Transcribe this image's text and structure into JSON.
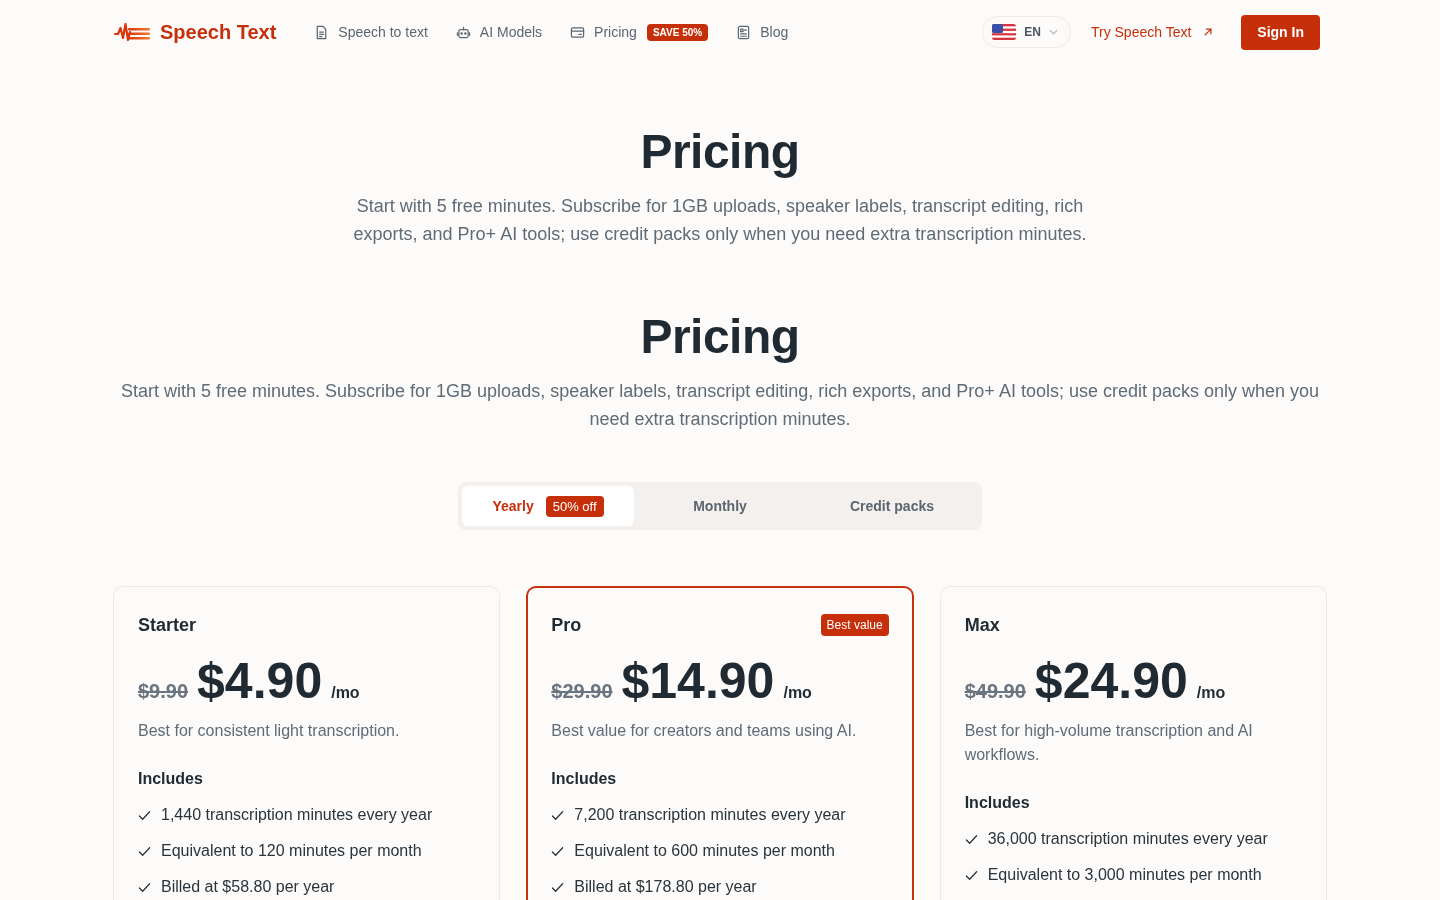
{
  "nav": {
    "brand": "Speech Text",
    "links": [
      {
        "label": "Speech to text"
      },
      {
        "label": "AI Models"
      },
      {
        "label": "Pricing",
        "badge": "SAVE 50%"
      },
      {
        "label": "Blog"
      }
    ],
    "language": "EN",
    "try_link": "Try Speech Text",
    "sign_in": "Sign In"
  },
  "page_header": {
    "title": "Pricing",
    "subtitle": "Start with 5 free minutes. Subscribe for 1GB uploads, speaker labels, transcript editing, rich exports, and Pro+ AI tools; use credit packs only when you need extra transcription minutes."
  },
  "pricing_section": {
    "title": "Pricing",
    "subtitle": "Start with 5 free minutes. Subscribe for 1GB uploads, speaker labels, transcript editing, rich exports, and Pro+ AI tools; use credit packs only when you need extra transcription minutes.",
    "billing_tabs": [
      {
        "label": "Yearly",
        "badge": "50% off",
        "selected": true
      },
      {
        "label": "Monthly",
        "selected": false
      },
      {
        "label": "Credit packs",
        "selected": false
      }
    ],
    "plans": [
      {
        "name": "Starter",
        "highlighted": false,
        "old_price": "$9.90",
        "price": "$4.90",
        "period": "/mo",
        "description": "Best for consistent light transcription.",
        "includes_label": "Includes",
        "features": [
          "1,440 transcription minutes every year",
          "Equivalent to 120 minutes per month",
          "Billed at $58.80 per year"
        ]
      },
      {
        "name": "Pro",
        "badge": "Best value",
        "highlighted": true,
        "old_price": "$29.90",
        "price": "$14.90",
        "period": "/mo",
        "description": "Best value for creators and teams using AI.",
        "includes_label": "Includes",
        "features": [
          "7,200 transcription minutes every year",
          "Equivalent to 600 minutes per month",
          "Billed at $178.80 per year"
        ]
      },
      {
        "name": "Max",
        "highlighted": false,
        "old_price": "$49.90",
        "price": "$24.90",
        "period": "/mo",
        "description": "Best for high-volume transcription and AI workflows.",
        "includes_label": "Includes",
        "features": [
          "36,000 transcription minutes every year",
          "Equivalent to 3,000 minutes per month"
        ]
      }
    ]
  }
}
